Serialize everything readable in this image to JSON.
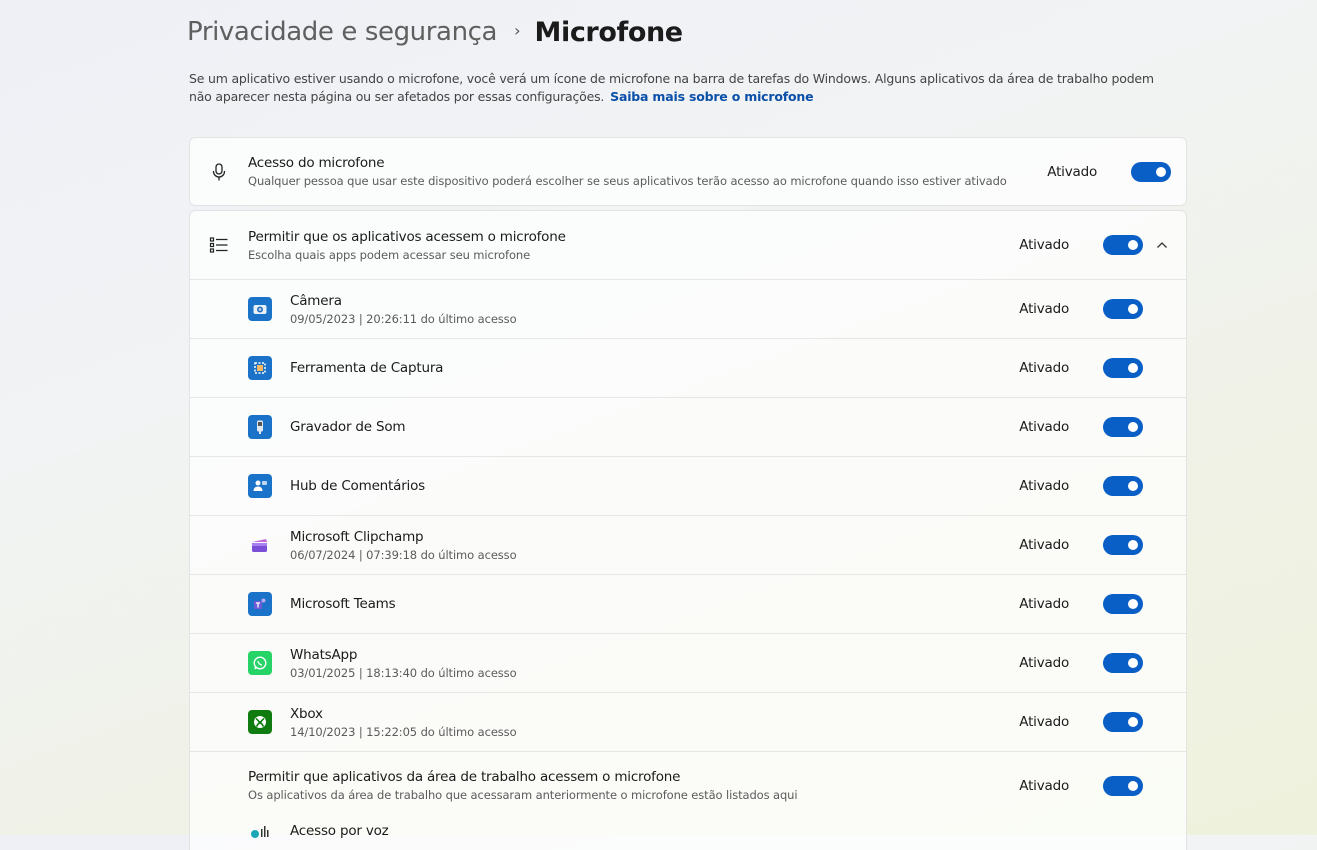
{
  "breadcrumb": {
    "parent": "Privacidade e segurança",
    "separator": "›",
    "current": "Microfone"
  },
  "description": {
    "text": "Se um aplicativo estiver usando o microfone, você verá um ícone de microfone na barra de tarefas do Windows. Alguns aplicativos da área de trabalho podem não aparecer nesta página ou ser afetados por essas configurações.",
    "link": "Saiba mais sobre o microfone"
  },
  "master": {
    "icon": "microphone-icon",
    "title": "Acesso do microfone",
    "subtitle": "Qualquer pessoa que usar este dispositivo poderá escolher se seus aplicativos terão acesso ao microfone quando isso estiver ativado",
    "state": "Ativado",
    "enabled": true
  },
  "apps_section": {
    "icon": "list-icon",
    "title": "Permitir que os aplicativos acessem o microfone",
    "subtitle": "Escolha quais apps podem acessar seu microfone",
    "state": "Ativado",
    "enabled": true,
    "expanded": true
  },
  "apps": [
    {
      "name": "Câmera",
      "subtitle": "09/05/2023  |  20:26:11 do último acesso",
      "state": "Ativado",
      "enabled": true,
      "icon": "camera-app-icon",
      "color": "#1a73c8"
    },
    {
      "name": "Ferramenta de Captura",
      "subtitle": "",
      "state": "Ativado",
      "enabled": true,
      "icon": "snipping-tool-icon",
      "color": "#1a73c8"
    },
    {
      "name": "Gravador de Som",
      "subtitle": "",
      "state": "Ativado",
      "enabled": true,
      "icon": "sound-recorder-icon",
      "color": "#1a73c8"
    },
    {
      "name": "Hub de Comentários",
      "subtitle": "",
      "state": "Ativado",
      "enabled": true,
      "icon": "feedback-hub-icon",
      "color": "#1a73c8"
    },
    {
      "name": "Microsoft Clipchamp",
      "subtitle": "06/07/2024  |  07:39:18 do último acesso",
      "state": "Ativado",
      "enabled": true,
      "icon": "clipchamp-icon",
      "color": "#7b4fd6"
    },
    {
      "name": "Microsoft Teams",
      "subtitle": "",
      "state": "Ativado",
      "enabled": true,
      "icon": "teams-icon",
      "color": "#1a73c8"
    },
    {
      "name": "WhatsApp",
      "subtitle": "03/01/2025  |  18:13:40 do último acesso",
      "state": "Ativado",
      "enabled": true,
      "icon": "whatsapp-icon",
      "color": "#25d366"
    },
    {
      "name": "Xbox",
      "subtitle": "14/10/2023  |  15:22:05 do último acesso",
      "state": "Ativado",
      "enabled": true,
      "icon": "xbox-icon",
      "color": "#107c10"
    }
  ],
  "desktop": {
    "title": "Permitir que aplicativos da área de trabalho acessem o microfone",
    "subtitle": "Os aplicativos da área de trabalho que acessaram anteriormente o microfone estão listados aqui",
    "state": "Ativado",
    "enabled": true
  },
  "partial_item": {
    "name": "Acesso por voz",
    "icon": "voice-access-icon"
  }
}
